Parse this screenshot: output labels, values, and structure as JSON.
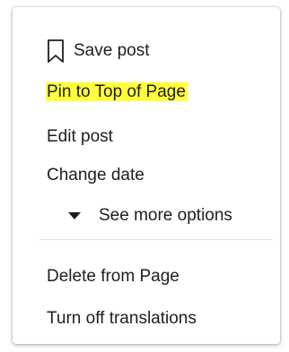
{
  "menu": {
    "items": [
      {
        "label": "Save post",
        "icon": "bookmark-icon"
      },
      {
        "label": "Pin to Top of Page",
        "highlight_color": "#ffff3b"
      },
      {
        "label": "Edit post"
      },
      {
        "label": "Change date"
      },
      {
        "label": "See more options",
        "icon": "caret-down-icon"
      },
      {
        "label": "Delete from Page"
      },
      {
        "label": "Turn off translations"
      }
    ]
  }
}
